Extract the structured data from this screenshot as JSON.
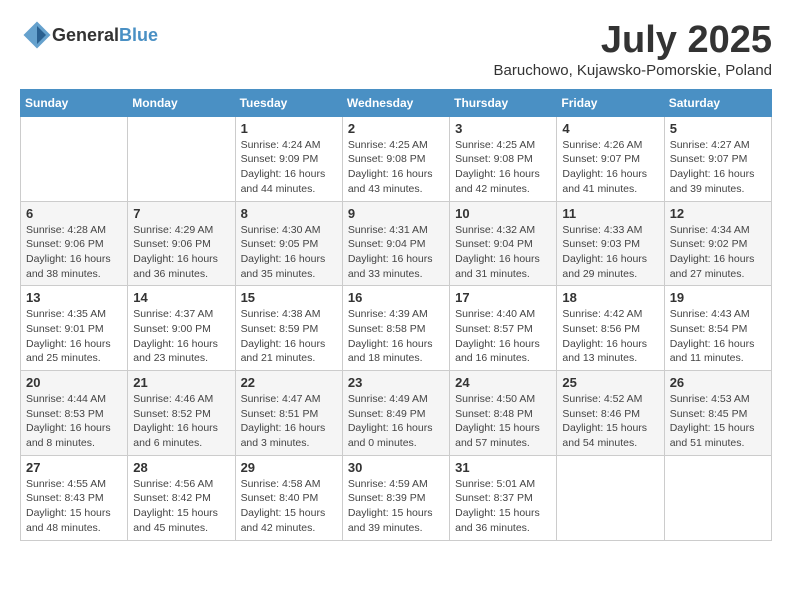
{
  "header": {
    "logo_general": "General",
    "logo_blue": "Blue",
    "month_title": "July 2025",
    "location": "Baruchowo, Kujawsko-Pomorskie, Poland"
  },
  "days_of_week": [
    "Sunday",
    "Monday",
    "Tuesday",
    "Wednesday",
    "Thursday",
    "Friday",
    "Saturday"
  ],
  "weeks": [
    [
      {
        "day": "",
        "detail": ""
      },
      {
        "day": "",
        "detail": ""
      },
      {
        "day": "1",
        "detail": "Sunrise: 4:24 AM\nSunset: 9:09 PM\nDaylight: 16 hours and 44 minutes."
      },
      {
        "day": "2",
        "detail": "Sunrise: 4:25 AM\nSunset: 9:08 PM\nDaylight: 16 hours and 43 minutes."
      },
      {
        "day": "3",
        "detail": "Sunrise: 4:25 AM\nSunset: 9:08 PM\nDaylight: 16 hours and 42 minutes."
      },
      {
        "day": "4",
        "detail": "Sunrise: 4:26 AM\nSunset: 9:07 PM\nDaylight: 16 hours and 41 minutes."
      },
      {
        "day": "5",
        "detail": "Sunrise: 4:27 AM\nSunset: 9:07 PM\nDaylight: 16 hours and 39 minutes."
      }
    ],
    [
      {
        "day": "6",
        "detail": "Sunrise: 4:28 AM\nSunset: 9:06 PM\nDaylight: 16 hours and 38 minutes."
      },
      {
        "day": "7",
        "detail": "Sunrise: 4:29 AM\nSunset: 9:06 PM\nDaylight: 16 hours and 36 minutes."
      },
      {
        "day": "8",
        "detail": "Sunrise: 4:30 AM\nSunset: 9:05 PM\nDaylight: 16 hours and 35 minutes."
      },
      {
        "day": "9",
        "detail": "Sunrise: 4:31 AM\nSunset: 9:04 PM\nDaylight: 16 hours and 33 minutes."
      },
      {
        "day": "10",
        "detail": "Sunrise: 4:32 AM\nSunset: 9:04 PM\nDaylight: 16 hours and 31 minutes."
      },
      {
        "day": "11",
        "detail": "Sunrise: 4:33 AM\nSunset: 9:03 PM\nDaylight: 16 hours and 29 minutes."
      },
      {
        "day": "12",
        "detail": "Sunrise: 4:34 AM\nSunset: 9:02 PM\nDaylight: 16 hours and 27 minutes."
      }
    ],
    [
      {
        "day": "13",
        "detail": "Sunrise: 4:35 AM\nSunset: 9:01 PM\nDaylight: 16 hours and 25 minutes."
      },
      {
        "day": "14",
        "detail": "Sunrise: 4:37 AM\nSunset: 9:00 PM\nDaylight: 16 hours and 23 minutes."
      },
      {
        "day": "15",
        "detail": "Sunrise: 4:38 AM\nSunset: 8:59 PM\nDaylight: 16 hours and 21 minutes."
      },
      {
        "day": "16",
        "detail": "Sunrise: 4:39 AM\nSunset: 8:58 PM\nDaylight: 16 hours and 18 minutes."
      },
      {
        "day": "17",
        "detail": "Sunrise: 4:40 AM\nSunset: 8:57 PM\nDaylight: 16 hours and 16 minutes."
      },
      {
        "day": "18",
        "detail": "Sunrise: 4:42 AM\nSunset: 8:56 PM\nDaylight: 16 hours and 13 minutes."
      },
      {
        "day": "19",
        "detail": "Sunrise: 4:43 AM\nSunset: 8:54 PM\nDaylight: 16 hours and 11 minutes."
      }
    ],
    [
      {
        "day": "20",
        "detail": "Sunrise: 4:44 AM\nSunset: 8:53 PM\nDaylight: 16 hours and 8 minutes."
      },
      {
        "day": "21",
        "detail": "Sunrise: 4:46 AM\nSunset: 8:52 PM\nDaylight: 16 hours and 6 minutes."
      },
      {
        "day": "22",
        "detail": "Sunrise: 4:47 AM\nSunset: 8:51 PM\nDaylight: 16 hours and 3 minutes."
      },
      {
        "day": "23",
        "detail": "Sunrise: 4:49 AM\nSunset: 8:49 PM\nDaylight: 16 hours and 0 minutes."
      },
      {
        "day": "24",
        "detail": "Sunrise: 4:50 AM\nSunset: 8:48 PM\nDaylight: 15 hours and 57 minutes."
      },
      {
        "day": "25",
        "detail": "Sunrise: 4:52 AM\nSunset: 8:46 PM\nDaylight: 15 hours and 54 minutes."
      },
      {
        "day": "26",
        "detail": "Sunrise: 4:53 AM\nSunset: 8:45 PM\nDaylight: 15 hours and 51 minutes."
      }
    ],
    [
      {
        "day": "27",
        "detail": "Sunrise: 4:55 AM\nSunset: 8:43 PM\nDaylight: 15 hours and 48 minutes."
      },
      {
        "day": "28",
        "detail": "Sunrise: 4:56 AM\nSunset: 8:42 PM\nDaylight: 15 hours and 45 minutes."
      },
      {
        "day": "29",
        "detail": "Sunrise: 4:58 AM\nSunset: 8:40 PM\nDaylight: 15 hours and 42 minutes."
      },
      {
        "day": "30",
        "detail": "Sunrise: 4:59 AM\nSunset: 8:39 PM\nDaylight: 15 hours and 39 minutes."
      },
      {
        "day": "31",
        "detail": "Sunrise: 5:01 AM\nSunset: 8:37 PM\nDaylight: 15 hours and 36 minutes."
      },
      {
        "day": "",
        "detail": ""
      },
      {
        "day": "",
        "detail": ""
      }
    ]
  ]
}
